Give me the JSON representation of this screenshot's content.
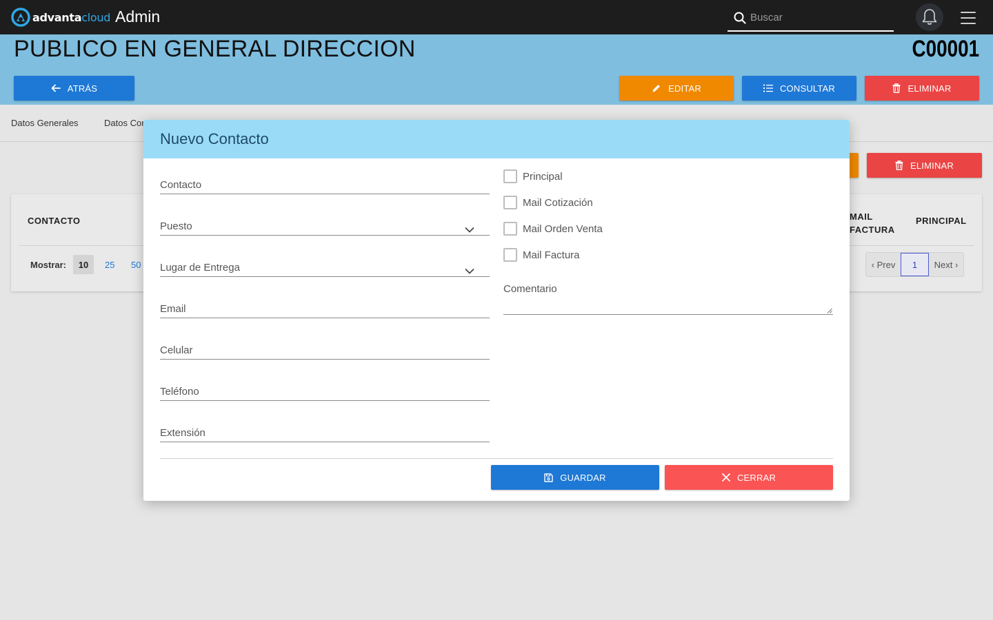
{
  "topbar": {
    "logo_brand": "advanta",
    "logo_accent": "cloud",
    "app_title": "Admin",
    "search_placeholder": "Buscar"
  },
  "header": {
    "client_name": "PUBLICO EN GENERAL DIRECCION",
    "client_code": "C00001",
    "back_label": "ATRÁS",
    "edit_label": "EDITAR",
    "consult_label": "CONSULTAR",
    "delete_label": "ELIMINAR"
  },
  "tabs": [
    {
      "label": "Datos Generales"
    },
    {
      "label": "Datos Con"
    }
  ],
  "contacts_card": {
    "delete_label": "ELIMINAR",
    "columns": {
      "contact": "CONTACTO",
      "mail_invoice_line1": "MAIL",
      "mail_invoice_line2": "FACTURA",
      "principal": "PRINCIPAL"
    },
    "show_label": "Mostrar:",
    "page_sizes": [
      "10",
      "25",
      "50"
    ],
    "selected_page_size": "10",
    "pager": {
      "prev": "‹ Prev",
      "current": "1",
      "next": "Next ›"
    }
  },
  "modal": {
    "title": "Nuevo Contacto",
    "fields": {
      "contacto": "Contacto",
      "puesto": "Puesto",
      "lugar_entrega": "Lugar de Entrega",
      "email": "Email",
      "celular": "Celular",
      "telefono": "Teléfono",
      "extension": "Extensión"
    },
    "checkboxes": {
      "principal": "Principal",
      "mail_cotizacion": "Mail Cotización",
      "mail_orden_venta": "Mail Orden Venta",
      "mail_factura": "Mail Factura"
    },
    "comment_label": "Comentario",
    "save_label": "GUARDAR",
    "close_label": "CERRAR"
  },
  "colors": {
    "topbar": "#1d1d1d",
    "header_band": "#7fbedf",
    "primary": "#1e78d6",
    "warning": "#f08800",
    "danger": "#ea4444",
    "modal_header": "#9adcf7"
  }
}
